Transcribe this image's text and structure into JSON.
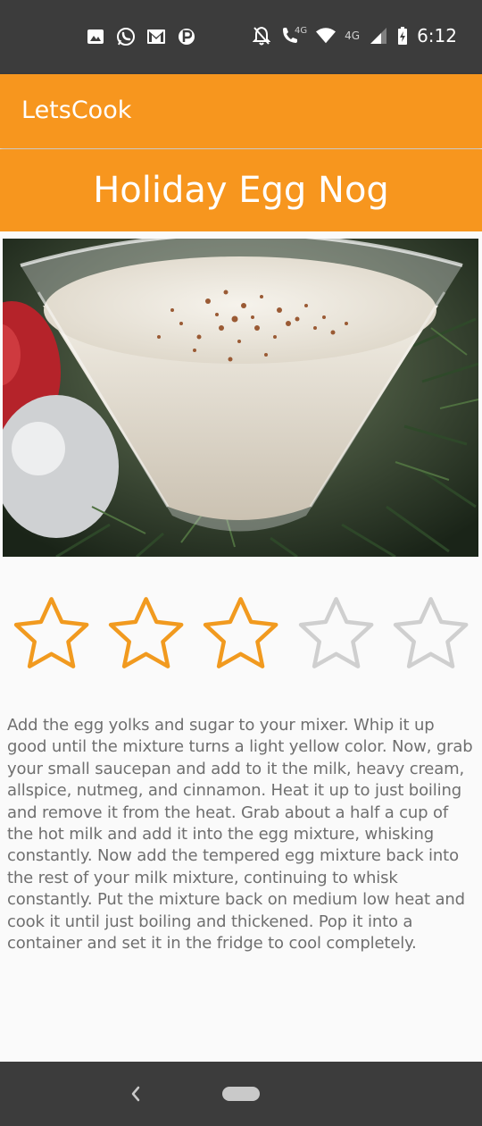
{
  "status_bar": {
    "time": "6:12",
    "network_label_1": "4G",
    "network_label_2": "4G",
    "left_icons": [
      "image-icon",
      "whatsapp-icon",
      "gmail-icon",
      "parking-icon"
    ],
    "right_icons": [
      "bell-off-icon",
      "volte-call-icon",
      "wifi-icon",
      "signal-icon",
      "battery-charging-icon"
    ]
  },
  "app_bar": {
    "title": "LetsCook"
  },
  "recipe": {
    "title": "Holiday Egg Nog",
    "image_description_icon": "egg-nog-photo",
    "rating": {
      "value": 3,
      "max": 5
    },
    "description": "Add the egg yolks and sugar to your mixer. Whip it up good until the mixture turns a light yellow color. Now, grab your small saucepan and add to it the milk, heavy cream, allspice, nutmeg, and cinnamon. Heat it up to just boiling and remove it from the heat. Grab about a half a cup of the hot milk and add it into the egg mixture, whisking constantly. Now add the tempered egg mixture back into the rest of your milk mixture, continuing to whisk constantly. Put the mixture back on medium low heat and cook it until just boiling and thickened. Pop it into a container and set it in the fridge to cool completely."
  },
  "colors": {
    "accent": "#f7961e",
    "star_filled": "#f19a1f",
    "star_empty": "#cfcfcf",
    "text": "#6f6f6f"
  },
  "nav_bar": {
    "icons": [
      "back-icon",
      "home-pill-icon"
    ]
  }
}
